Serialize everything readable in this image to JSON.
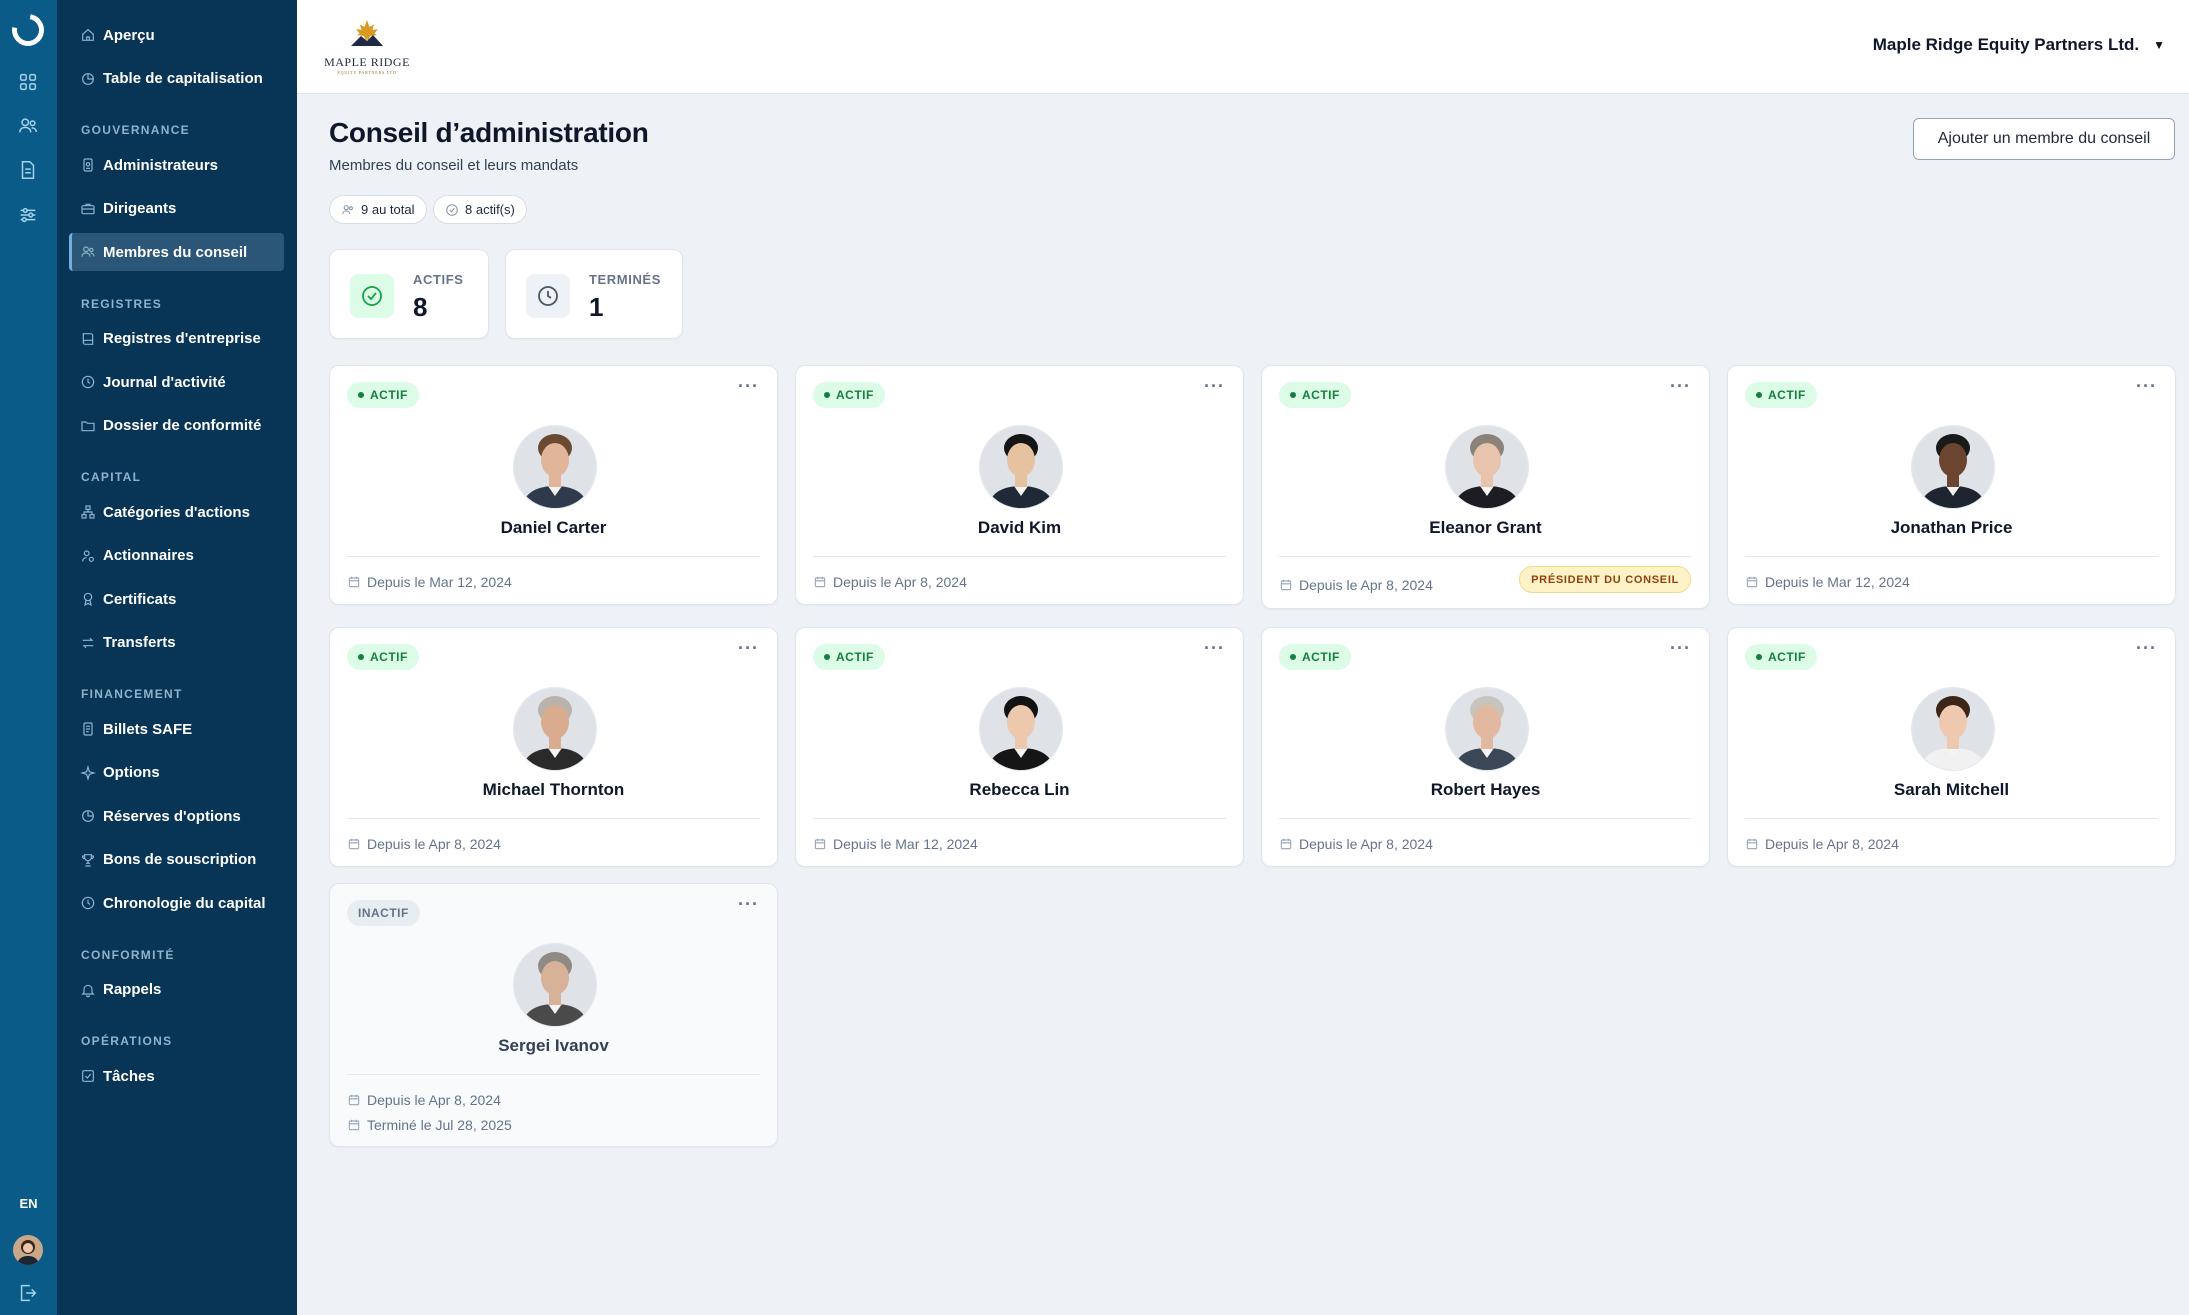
{
  "rail": {
    "icons": [
      "apps-grid-icon",
      "users-icon",
      "document-icon",
      "sliders-icon"
    ],
    "lang": "EN"
  },
  "sidebar": {
    "top": [
      {
        "label": "Aperçu",
        "icon": "home-icon"
      },
      {
        "label": "Table de capitalisation",
        "icon": "pie-chart-icon"
      }
    ],
    "sections": [
      {
        "title": "GOUVERNANCE",
        "items": [
          {
            "label": "Administrateurs",
            "icon": "id-badge-icon"
          },
          {
            "label": "Dirigeants",
            "icon": "briefcase-icon"
          },
          {
            "label": "Membres du conseil",
            "icon": "users-icon",
            "active": true
          }
        ]
      },
      {
        "title": "REGISTRES",
        "items": [
          {
            "label": "Registres d'entreprise",
            "icon": "book-icon"
          },
          {
            "label": "Journal d'activité",
            "icon": "clock-icon"
          },
          {
            "label": "Dossier de conformité",
            "icon": "folder-icon"
          }
        ]
      },
      {
        "title": "CAPITAL",
        "items": [
          {
            "label": "Catégories d'actions",
            "icon": "hierarchy-icon"
          },
          {
            "label": "Actionnaires",
            "icon": "user-group-icon"
          },
          {
            "label": "Certificats",
            "icon": "award-icon"
          },
          {
            "label": "Transferts",
            "icon": "transfer-icon"
          }
        ]
      },
      {
        "title": "FINANCEMENT",
        "items": [
          {
            "label": "Billets SAFE",
            "icon": "note-icon"
          },
          {
            "label": "Options",
            "icon": "sparkle-icon"
          },
          {
            "label": "Réserves d'options",
            "icon": "pie-chart-icon"
          },
          {
            "label": "Bons de souscription",
            "icon": "trophy-icon"
          },
          {
            "label": "Chronologie du capital",
            "icon": "clock-icon"
          }
        ]
      },
      {
        "title": "CONFORMITÉ",
        "items": [
          {
            "label": "Rappels",
            "icon": "bell-icon"
          }
        ]
      },
      {
        "title": "OPÉRATIONS",
        "items": [
          {
            "label": "Tâches",
            "icon": "checkbox-icon"
          }
        ]
      }
    ]
  },
  "header": {
    "logo_text": "MAPLE RIDGE",
    "logo_sub": "EQUITY PARTNERS LTD",
    "company": "Maple Ridge Equity Partners Ltd."
  },
  "page": {
    "title": "Conseil d’administration",
    "subtitle": "Membres du conseil et leurs mandats",
    "add_button": "Ajouter un membre du conseil",
    "pill_total": "9 au total",
    "pill_active": "8 actif(s)"
  },
  "stats": [
    {
      "label": "ACTIFS",
      "value": "8",
      "color": "#16a34a"
    },
    {
      "label": "TERMINÉS",
      "value": "1",
      "color": "#475569"
    }
  ],
  "colors": {
    "rail": "#0b5b88",
    "sidebar": "#083456",
    "active_green": "#15803d",
    "chair_badge": "#fef3c7"
  },
  "members": [
    {
      "name": "Daniel Carter",
      "status": "ACTIF",
      "since": "Depuis le Mar 12, 2024",
      "skin": "#e0b59a",
      "hair": "#6b4a33",
      "suit": "#2f3b4d"
    },
    {
      "name": "David Kim",
      "status": "ACTIF",
      "since": "Depuis le Apr 8, 2024",
      "skin": "#e6c2a0",
      "hair": "#151515",
      "suit": "#1f2937"
    },
    {
      "name": "Eleanor Grant",
      "status": "ACTIF",
      "since": "Depuis le Apr 8, 2024",
      "role": "PRÉSIDENT DU CONSEIL",
      "skin": "#e8c4ad",
      "hair": "#8c8278",
      "suit": "#1c1c22"
    },
    {
      "name": "Jonathan Price",
      "status": "ACTIF",
      "since": "Depuis le Mar 12, 2024",
      "skin": "#6b4530",
      "hair": "#1a1a1a",
      "suit": "#1e2430"
    },
    {
      "name": "Michael Thornton",
      "status": "ACTIF",
      "since": "Depuis le Apr 8, 2024",
      "skin": "#d9ac90",
      "hair": "#b9b3ab",
      "suit": "#2a2a2a"
    },
    {
      "name": "Rebecca Lin",
      "status": "ACTIF",
      "since": "Depuis le Mar 12, 2024",
      "skin": "#ecc8ad",
      "hair": "#121212",
      "suit": "#151515"
    },
    {
      "name": "Robert Hayes",
      "status": "ACTIF",
      "since": "Depuis le Apr 8, 2024",
      "skin": "#e2b9a0",
      "hair": "#c7c3bd",
      "suit": "#3b4656"
    },
    {
      "name": "Sarah Mitchell",
      "status": "ACTIF",
      "since": "Depuis le Apr 8, 2024",
      "skin": "#eec9b0",
      "hair": "#3d2618",
      "suit": "#f1f1f1"
    },
    {
      "name": "Sergei Ivanov",
      "status": "INACTIF",
      "since": "Depuis le Apr 8, 2024",
      "ended": "Terminé le Jul 28, 2025",
      "skin": "#d8b298",
      "hair": "#8f8a84",
      "suit": "#4a4a4a"
    }
  ]
}
